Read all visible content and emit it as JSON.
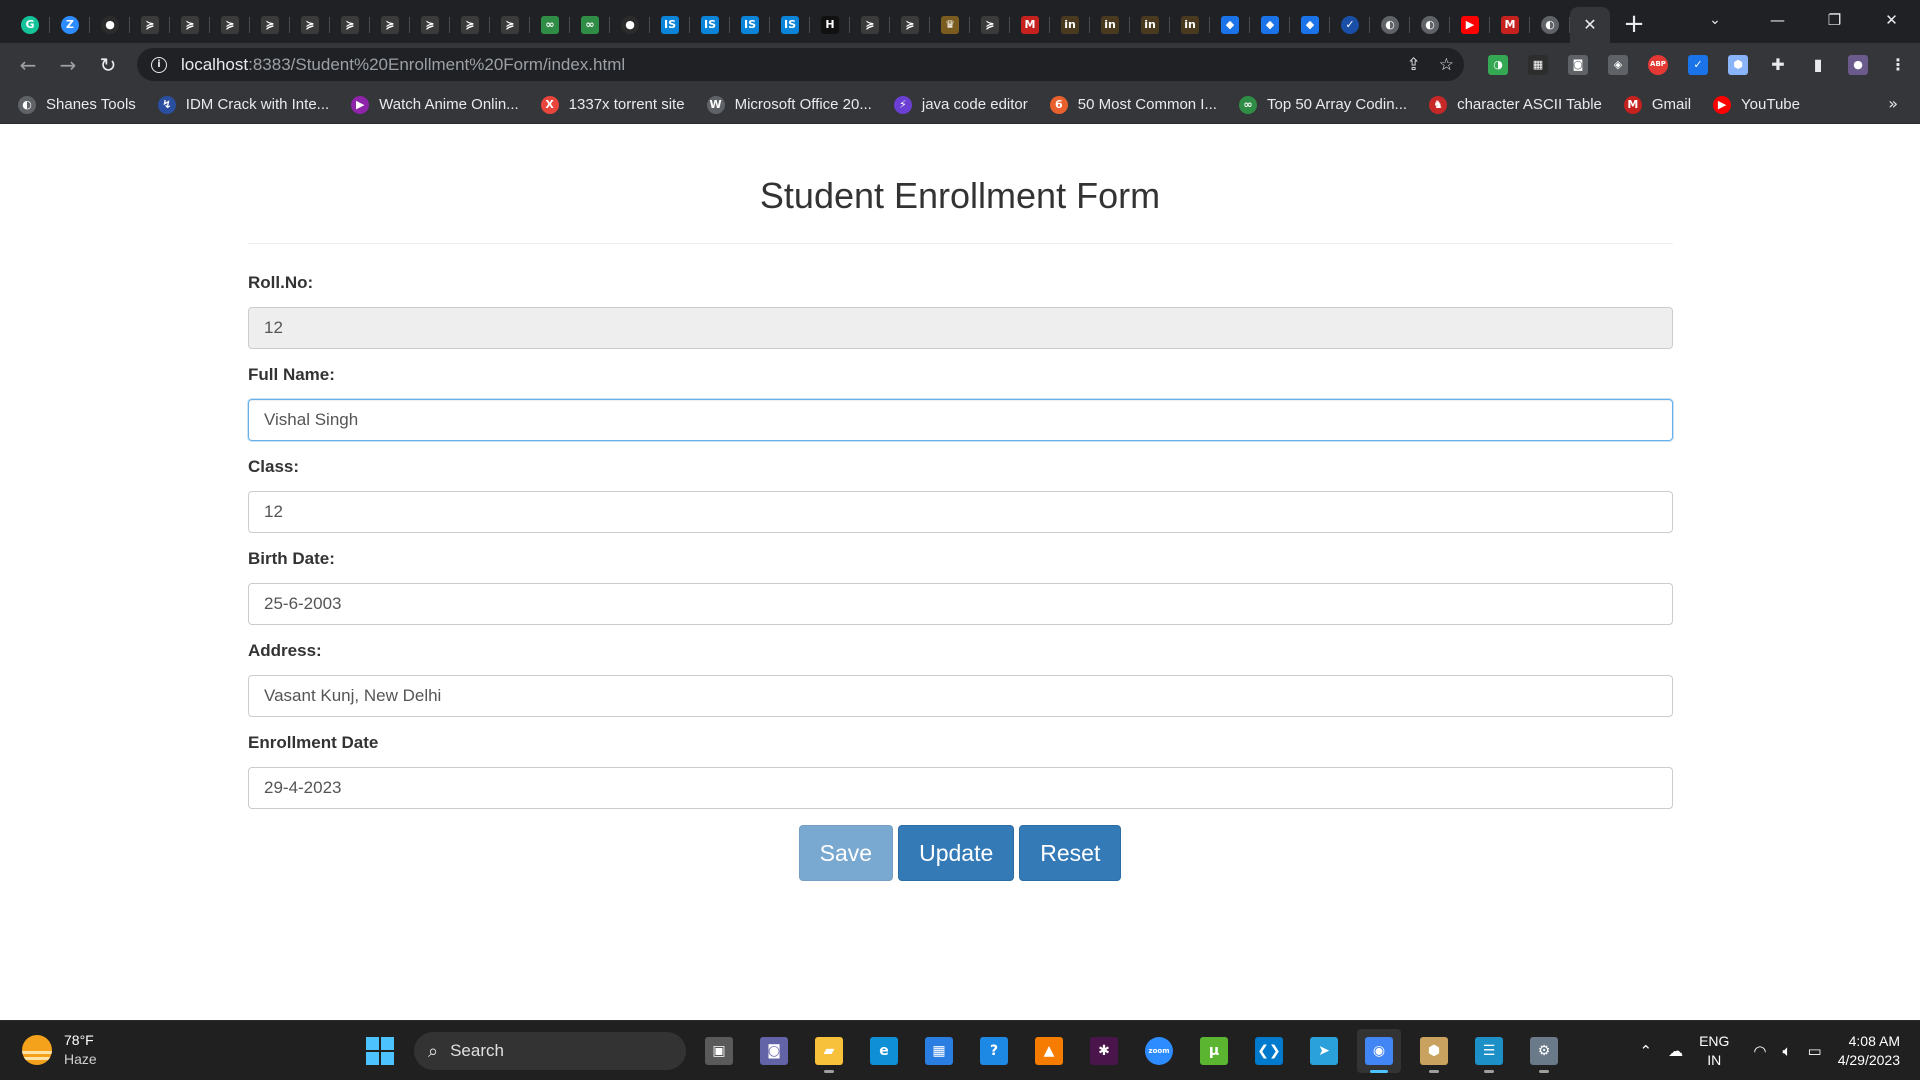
{
  "browser": {
    "tabs": [
      {
        "icon": "grammarly-icon",
        "glyph": "G",
        "color": "#15c39a",
        "round": true
      },
      {
        "icon": "zoom-icon",
        "glyph": "Z",
        "color": "#2d8cff",
        "round": true
      },
      {
        "icon": "github-icon",
        "glyph": "●",
        "color": "#2b2b2b",
        "round": true
      },
      {
        "icon": "cursor-icon",
        "glyph": "≽",
        "color": "#3b3b3b"
      },
      {
        "icon": "cursor-icon",
        "glyph": "≽",
        "color": "#3b3b3b"
      },
      {
        "icon": "cursor-icon",
        "glyph": "≽",
        "color": "#3b3b3b"
      },
      {
        "icon": "cursor-icon",
        "glyph": "≽",
        "color": "#3b3b3b"
      },
      {
        "icon": "cursor-icon",
        "glyph": "≽",
        "color": "#3b3b3b"
      },
      {
        "icon": "cursor-icon",
        "glyph": "≽",
        "color": "#3b3b3b"
      },
      {
        "icon": "cursor-icon",
        "glyph": "≽",
        "color": "#3b3b3b"
      },
      {
        "icon": "cursor-icon",
        "glyph": "≽",
        "color": "#3b3b3b"
      },
      {
        "icon": "cursor-icon",
        "glyph": "≽",
        "color": "#3b3b3b"
      },
      {
        "icon": "cursor-icon",
        "glyph": "≽",
        "color": "#3b3b3b"
      },
      {
        "icon": "geeksforgeeks-icon",
        "glyph": "∞",
        "color": "#2f8d46"
      },
      {
        "icon": "geeksforgeeks-icon",
        "glyph": "∞",
        "color": "#2f8d46"
      },
      {
        "icon": "github-icon",
        "glyph": "●",
        "color": "#2b2b2b",
        "round": true
      },
      {
        "icon": "is-icon",
        "glyph": "IS",
        "color": "#0a84d8"
      },
      {
        "icon": "is-icon",
        "glyph": "IS",
        "color": "#0a84d8"
      },
      {
        "icon": "is-icon",
        "glyph": "IS",
        "color": "#0a84d8"
      },
      {
        "icon": "is-icon",
        "glyph": "IS",
        "color": "#0a84d8"
      },
      {
        "icon": "hackerrank-icon",
        "glyph": "H",
        "color": "#111111"
      },
      {
        "icon": "cursor-icon",
        "glyph": "≽",
        "color": "#3b3b3b"
      },
      {
        "icon": "cursor-icon",
        "glyph": "≽",
        "color": "#3b3b3b"
      },
      {
        "icon": "trophy-icon",
        "glyph": "♛",
        "color": "#7a5c20"
      },
      {
        "icon": "cursor-icon",
        "glyph": "≽",
        "color": "#3b3b3b"
      },
      {
        "icon": "gmail-icon",
        "glyph": "M",
        "color": "#c5221f"
      },
      {
        "icon": "in-icon",
        "glyph": "in",
        "color": "#4a3a20"
      },
      {
        "icon": "in-icon",
        "glyph": "in",
        "color": "#4a3a20"
      },
      {
        "icon": "in-icon",
        "glyph": "in",
        "color": "#4a3a20"
      },
      {
        "icon": "in-icon",
        "glyph": "in",
        "color": "#4a3a20"
      },
      {
        "icon": "cube-icon",
        "glyph": "◆",
        "color": "#1a73e8"
      },
      {
        "icon": "cube-icon",
        "glyph": "◆",
        "color": "#1a73e8"
      },
      {
        "icon": "cube-icon",
        "glyph": "◆",
        "color": "#1a73e8"
      },
      {
        "icon": "check-icon",
        "glyph": "✓",
        "color": "#1a4fa8",
        "round": true
      },
      {
        "icon": "globe-icon",
        "glyph": "◐",
        "color": "#5f6368",
        "round": true
      },
      {
        "icon": "globe-icon",
        "glyph": "◐",
        "color": "#5f6368",
        "round": true
      },
      {
        "icon": "youtube-icon",
        "glyph": "▶",
        "color": "#ff0000"
      },
      {
        "icon": "gmail-icon",
        "glyph": "M",
        "color": "#c5221f"
      },
      {
        "icon": "globe-icon",
        "glyph": "◐",
        "color": "#5f6368",
        "round": true
      }
    ],
    "active_tab_close": "✕",
    "new_tab": "+",
    "url_host": "localhost",
    "url_rest": ":8383/Student%20Enrollment%20Form/index.html"
  },
  "extensions": [
    {
      "icon": "extension-green-icon",
      "glyph": "◑",
      "color": "#34a853"
    },
    {
      "icon": "extension-calendar-icon",
      "glyph": "▦",
      "color": "#2d2d2d"
    },
    {
      "icon": "camera-icon",
      "glyph": "◙",
      "color": "#5f6368"
    },
    {
      "icon": "shield-icon",
      "glyph": "◈",
      "color": "#5f6368"
    },
    {
      "icon": "adblock-icon",
      "glyph": "ABP",
      "color": "#e53935"
    },
    {
      "icon": "check-extension-icon",
      "glyph": "✓",
      "color": "#1a73e8"
    },
    {
      "icon": "cube-extension-icon",
      "glyph": "⬢",
      "color": "#8ab4f8"
    },
    {
      "icon": "puzzle-icon",
      "glyph": "✚",
      "color": "#35363a"
    },
    {
      "icon": "sidepanel-icon",
      "glyph": "▮",
      "color": "#35363a"
    },
    {
      "icon": "profile-avatar-icon",
      "glyph": "●",
      "color": "#6b5a8c"
    },
    {
      "icon": "kebab-menu-icon",
      "glyph": "⋮",
      "color": "#35363a"
    }
  ],
  "bookmarks": [
    {
      "label": "Shanes Tools",
      "icon": "globe-icon",
      "glyph": "◐",
      "color": "#5f6368"
    },
    {
      "label": "IDM Crack with Inte...",
      "icon": "idm-icon",
      "glyph": "↯",
      "color": "#2b4fa0"
    },
    {
      "label": "Watch Anime Onlin...",
      "icon": "anime-icon",
      "glyph": "▶",
      "color": "#8e24aa"
    },
    {
      "label": "1337x torrent site",
      "icon": "x-icon",
      "glyph": "X",
      "color": "#e8453c"
    },
    {
      "label": "Microsoft Office 20...",
      "icon": "wordpress-icon",
      "glyph": "W",
      "color": "#5f6368"
    },
    {
      "label": "java code editor",
      "icon": "lightning-icon",
      "glyph": "⚡",
      "color": "#6b3fd4"
    },
    {
      "label": "50 Most Common I...",
      "icon": "orange-circle-icon",
      "glyph": "6",
      "color": "#e8602c"
    },
    {
      "label": "Top 50 Array Codin...",
      "icon": "geeksforgeeks-icon",
      "glyph": "∞",
      "color": "#2f8d46"
    },
    {
      "label": "character ASCII Table",
      "icon": "ascii-icon",
      "glyph": "♞",
      "color": "#c62828"
    },
    {
      "label": "Gmail",
      "icon": "gmail-icon",
      "glyph": "M",
      "color": "#c5221f"
    },
    {
      "label": "YouTube",
      "icon": "youtube-icon",
      "glyph": "▶",
      "color": "#ff0000"
    }
  ],
  "bookmarks_more": "»",
  "form": {
    "title": "Student Enrollment Form",
    "fields": [
      {
        "name": "roll-no",
        "label": "Roll.No:",
        "value": "12",
        "state": "disabled"
      },
      {
        "name": "full-name",
        "label": "Full Name:",
        "value": "Vishal Singh",
        "state": "focus"
      },
      {
        "name": "class",
        "label": "Class:",
        "value": "12",
        "state": "normal"
      },
      {
        "name": "birth-date",
        "label": "Birth Date:",
        "value": "25-6-2003",
        "state": "normal"
      },
      {
        "name": "address",
        "label": "Address:",
        "value": "Vasant Kunj, New Delhi",
        "state": "normal"
      },
      {
        "name": "enrollment-date",
        "label": "Enrollment Date",
        "value": "29-4-2023",
        "state": "normal"
      }
    ],
    "buttons": [
      {
        "name": "save-button",
        "label": "Save",
        "disabled": true
      },
      {
        "name": "update-button",
        "label": "Update",
        "disabled": false
      },
      {
        "name": "reset-button",
        "label": "Reset",
        "disabled": false
      }
    ],
    "primary_color": "#337ab7"
  },
  "taskbar": {
    "weather_temp": "78°F",
    "weather_cond": "Haze",
    "search_label": "Search",
    "apps": [
      {
        "icon": "task-view-icon",
        "glyph": "▣",
        "color": "#5a5a5a",
        "running": false
      },
      {
        "icon": "teams-chat-icon",
        "glyph": "◙",
        "color": "#6264a7",
        "running": false
      },
      {
        "icon": "file-explorer-icon",
        "glyph": "▰",
        "color": "#f8c13c",
        "running": true
      },
      {
        "icon": "edge-icon",
        "glyph": "e",
        "color": "#0f8fd6",
        "running": false
      },
      {
        "icon": "store-icon",
        "glyph": "▦",
        "color": "#2a7de1",
        "running": false
      },
      {
        "icon": "help-icon",
        "glyph": "?",
        "color": "#1e88e5",
        "running": false
      },
      {
        "icon": "vlc-icon",
        "glyph": "▲",
        "color": "#f57c00",
        "running": false
      },
      {
        "icon": "slack-icon",
        "glyph": "✱",
        "color": "#4a154b",
        "running": false
      },
      {
        "icon": "zoom-icon",
        "glyph": "zoom",
        "color": "#2d8cff",
        "running": false
      },
      {
        "icon": "utorrent-icon",
        "glyph": "µ",
        "color": "#5cb531",
        "running": false
      },
      {
        "icon": "vscode-icon",
        "glyph": "❮❯",
        "color": "#007acc",
        "running": false
      },
      {
        "icon": "telegram-icon",
        "glyph": "➤",
        "color": "#2aa1da",
        "running": false
      },
      {
        "icon": "chrome-icon",
        "glyph": "◉",
        "color": "#4285f4",
        "running": true,
        "active": true
      },
      {
        "icon": "netbeans-icon",
        "glyph": "⬢",
        "color": "#c8a25e",
        "running": true
      },
      {
        "icon": "notepad-icon",
        "glyph": "☰",
        "color": "#1e90c8",
        "running": true
      },
      {
        "icon": "settings-icon",
        "glyph": "⚙",
        "color": "#6b7a89",
        "running": true
      }
    ],
    "lang_top": "ENG",
    "lang_bottom": "IN",
    "time": "4:08 AM",
    "date": "4/29/2023"
  }
}
